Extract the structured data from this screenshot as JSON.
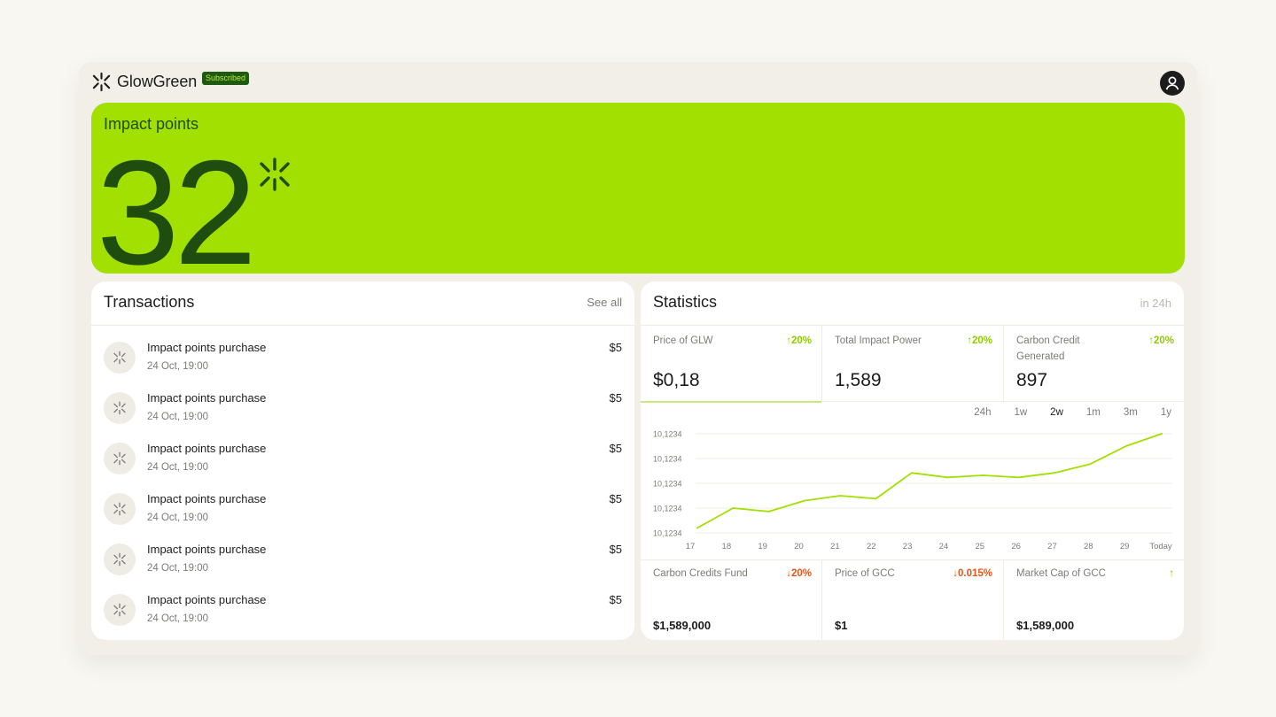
{
  "app": {
    "brand_name": "GlowGreen",
    "badge": "Subscribed",
    "accent_color": "#a1e000",
    "dark_green": "#1f4d10",
    "avatar_icon": "user-icon",
    "brand_icon": "asterisk-icon"
  },
  "hero": {
    "title": "Impact points",
    "value": "32"
  },
  "transactions": {
    "title": "Transactions",
    "see_all": "See all",
    "items": [
      {
        "name": "Impact points purchase",
        "date": "24 Oct, 19:00",
        "amount": "$5"
      },
      {
        "name": "Impact points purchase",
        "date": "24 Oct, 19:00",
        "amount": "$5"
      },
      {
        "name": "Impact points purchase",
        "date": "24 Oct, 19:00",
        "amount": "$5"
      },
      {
        "name": "Impact points purchase",
        "date": "24 Oct, 19:00",
        "amount": "$5"
      },
      {
        "name": "Impact points purchase",
        "date": "24 Oct, 19:00",
        "amount": "$5"
      },
      {
        "name": "Impact points purchase",
        "date": "24 Oct, 19:00",
        "amount": "$5"
      }
    ]
  },
  "statistics": {
    "title": "Statistics",
    "period_note": "in 24h",
    "metrics": [
      {
        "label": "Price of GLW",
        "delta": "20%",
        "value": "$0,18",
        "direction": "up"
      },
      {
        "label": "Total Impact Power",
        "delta": "20%",
        "value": "1,589",
        "direction": "up"
      },
      {
        "label": "Carbon Credit Generated",
        "delta": "20%",
        "value": "897",
        "direction": "up"
      }
    ],
    "ranges": [
      "24h",
      "1w",
      "2w",
      "1m",
      "3m",
      "1y"
    ],
    "active_range": "2w",
    "bottom_metrics": [
      {
        "label": "Carbon Credits Fund",
        "delta": "20%",
        "value": "$1,589,000",
        "direction": "down"
      },
      {
        "label": "Price of GCC",
        "delta": "0.015%",
        "value": "$1",
        "direction": "down"
      },
      {
        "label": "Market Cap of GCC",
        "delta": "",
        "value": "$1,589,000",
        "direction": "up"
      }
    ]
  },
  "chart_data": {
    "type": "line",
    "title": "",
    "xlabel": "",
    "ylabel": "",
    "categories": [
      "17",
      "18",
      "19",
      "20",
      "21",
      "22",
      "23",
      "24",
      "25",
      "26",
      "27",
      "28",
      "29",
      "Today"
    ],
    "y_tick_labels": [
      "10,1234",
      "10,1234",
      "10,1234",
      "10,1234",
      "10,1234"
    ],
    "ylim": [
      0,
      4
    ],
    "grid": true,
    "line_color": "#a1e000",
    "series": [
      {
        "values": [
          0.2,
          1.0,
          0.86,
          1.3,
          1.5,
          1.38,
          2.42,
          2.24,
          2.32,
          2.24,
          2.42,
          2.78,
          3.5,
          4.0
        ]
      }
    ]
  }
}
